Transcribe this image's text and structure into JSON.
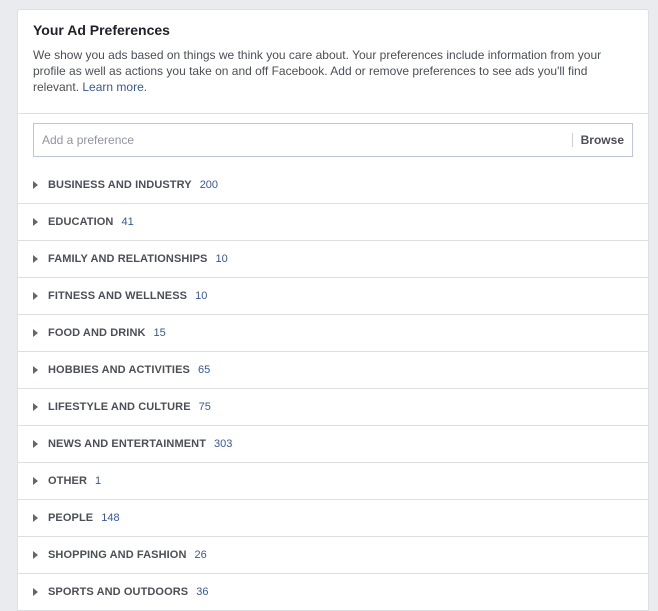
{
  "header": {
    "title": "Your Ad Preferences",
    "description": "We show you ads based on things we think you care about. Your preferences include information from your profile as well as actions you take on and off Facebook. Add or remove preferences to see ads you'll find relevant.",
    "learn_more": "Learn more."
  },
  "search": {
    "placeholder": "Add a preference",
    "value": "",
    "browse_label": "Browse"
  },
  "categories": [
    {
      "label": "BUSINESS AND INDUSTRY",
      "count": "200"
    },
    {
      "label": "EDUCATION",
      "count": "41"
    },
    {
      "label": "FAMILY AND RELATIONSHIPS",
      "count": "10"
    },
    {
      "label": "FITNESS AND WELLNESS",
      "count": "10"
    },
    {
      "label": "FOOD AND DRINK",
      "count": "15"
    },
    {
      "label": "HOBBIES AND ACTIVITIES",
      "count": "65"
    },
    {
      "label": "LIFESTYLE AND CULTURE",
      "count": "75"
    },
    {
      "label": "NEWS AND ENTERTAINMENT",
      "count": "303"
    },
    {
      "label": "OTHER",
      "count": "1"
    },
    {
      "label": "PEOPLE",
      "count": "148"
    },
    {
      "label": "SHOPPING AND FASHION",
      "count": "26"
    },
    {
      "label": "SPORTS AND OUTDOORS",
      "count": "36"
    }
  ]
}
